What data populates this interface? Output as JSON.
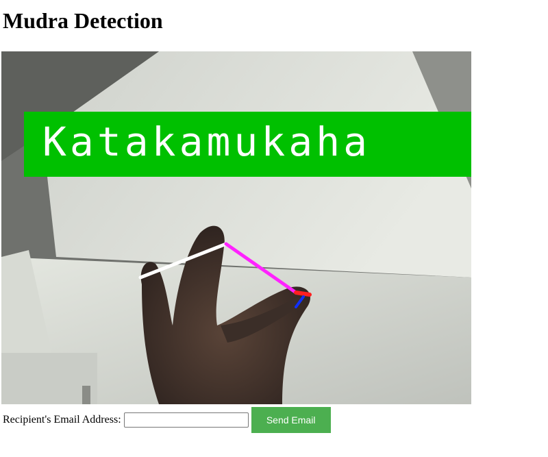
{
  "page": {
    "title": "Mudra Detection"
  },
  "video": {
    "detected_mudra": "Katakamukaha",
    "label_background": "#00c000",
    "label_text_color": "#ffffff"
  },
  "email_form": {
    "label": "Recipient's Email Address:",
    "input_value": "",
    "input_placeholder": "",
    "send_label": "Send Email",
    "send_button_color": "#4caf50"
  }
}
